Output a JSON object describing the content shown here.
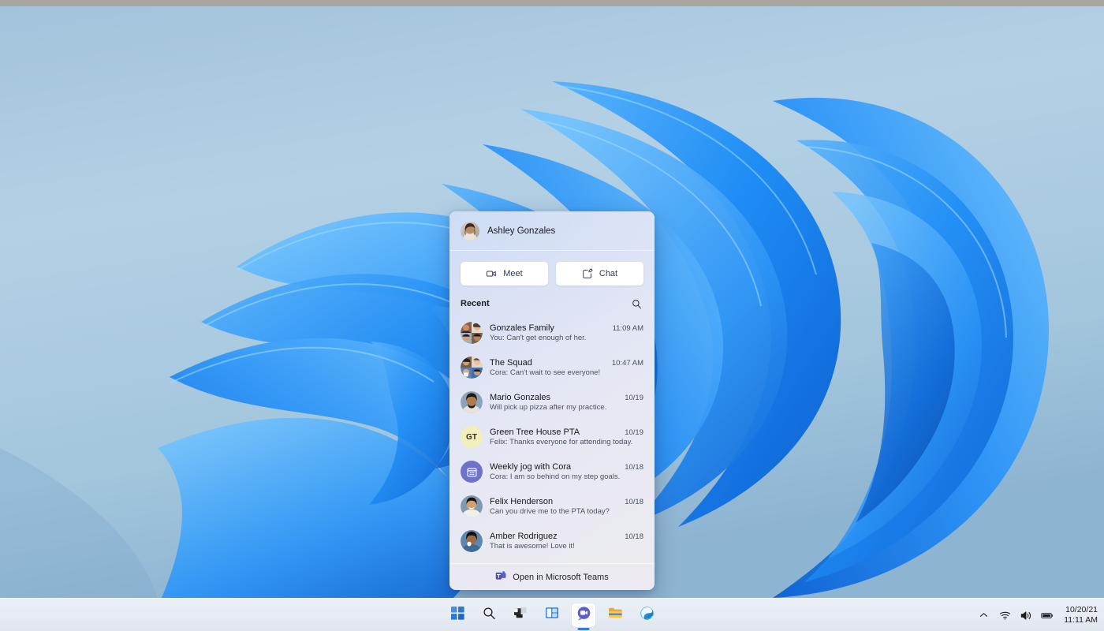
{
  "desktop": {
    "wallpaper_name": "windows-11-bloom-wallpaper",
    "sky_color": "#a9c8de",
    "ribbon_color": "#1f8df5",
    "ribbon_color_light": "#55b2fb"
  },
  "chat_panel": {
    "header": {
      "avatar_name": "ashley-gonzales-avatar",
      "user_name": "Ashley Gonzales"
    },
    "actions": [
      {
        "id": "meet",
        "label": "Meet",
        "icon": "video-camera-icon"
      },
      {
        "id": "chat",
        "label": "Chat",
        "icon": "compose-message-icon"
      }
    ],
    "recent": {
      "label": "Recent",
      "search_icon": "search-icon"
    },
    "items": [
      {
        "title": "Gonzales Family",
        "preview": "You: Can't get enough of her.",
        "time": "11:09 AM",
        "avatar_type": "photo-group",
        "avatar_color": "#b47a5a"
      },
      {
        "title": "The Squad",
        "preview": "Cora: Can't wait to see everyone!",
        "time": "10:47 AM",
        "avatar_type": "photo-group",
        "avatar_color": "#6e93c4"
      },
      {
        "title": "Mario Gonzales",
        "preview": "Will pick up pizza after my practice.",
        "time": "10/19",
        "avatar_type": "photo",
        "avatar_color": "#9c6b4e"
      },
      {
        "title": "Green Tree House PTA",
        "preview": "Felix: Thanks everyone for attending today.",
        "time": "10/19",
        "avatar_type": "initials",
        "initials": "GT",
        "avatar_color": "#f1f0bb",
        "initials_color": "#2b2b2b"
      },
      {
        "title": "Weekly jog with Cora",
        "preview": "Cora: I am so behind on my step goals.",
        "time": "10/18",
        "avatar_type": "icon",
        "avatar_icon": "calendar-icon",
        "avatar_color": "#6f72c9"
      },
      {
        "title": "Felix Henderson",
        "preview": "Can you drive me to the PTA today?",
        "time": "10/18",
        "avatar_type": "photo",
        "avatar_color": "#c08a63"
      },
      {
        "title": "Amber Rodriguez",
        "preview": "That is awesome! Love it!",
        "time": "10/18",
        "avatar_type": "photo",
        "avatar_color": "#8a6a55"
      }
    ],
    "footer": {
      "label": "Open in Microsoft Teams",
      "icon": "microsoft-teams-icon"
    }
  },
  "taskbar": {
    "buttons": [
      {
        "id": "start",
        "icon": "windows-start-icon",
        "label": "Start",
        "active": false
      },
      {
        "id": "search",
        "icon": "search-icon",
        "label": "Search",
        "active": false
      },
      {
        "id": "task-view",
        "icon": "task-view-icon",
        "label": "Task View",
        "active": false
      },
      {
        "id": "widgets",
        "icon": "widgets-icon",
        "label": "Widgets",
        "active": false
      },
      {
        "id": "chat",
        "icon": "teams-chat-icon",
        "label": "Chat",
        "active": true
      },
      {
        "id": "file-explorer",
        "icon": "file-explorer-icon",
        "label": "File Explorer",
        "active": false
      },
      {
        "id": "edge",
        "icon": "microsoft-edge-icon",
        "label": "Microsoft Edge",
        "active": false
      }
    ],
    "tray": {
      "chevron_icon": "chevron-up-icon",
      "network_icon": "wifi-icon",
      "volume_icon": "speaker-icon",
      "battery_icon": "battery-icon",
      "date": "10/20/21",
      "time": "11:11 AM"
    }
  }
}
